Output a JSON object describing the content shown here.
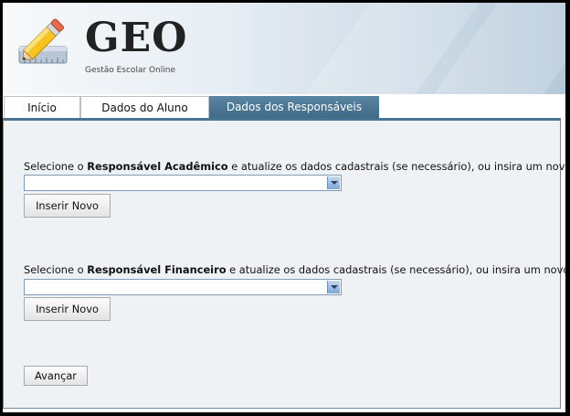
{
  "brand": {
    "name": "GEO",
    "tagline": "Gestão Escolar Online"
  },
  "tabs": [
    {
      "label": "Início",
      "active": false
    },
    {
      "label": "Dados do Aluno",
      "active": false
    },
    {
      "label": "Dados dos Responsáveis",
      "active": true
    }
  ],
  "academic": {
    "prefix": "Selecione o ",
    "emphasis": "Responsável Acadêmico",
    "suffix": " e atualize os dados cadastrais (se necessário), ou insira um novo",
    "selected_value": "",
    "insert_label": "Inserir Novo"
  },
  "financial": {
    "prefix": "Selecione o ",
    "emphasis": "Responsável Financeiro",
    "suffix": " e atualize os dados cadastrais (se necessário), ou insira um novo",
    "selected_value": "",
    "insert_label": "Inserir Novo"
  },
  "advance_label": "Avançar",
  "colors": {
    "accent": "#4a7592",
    "panel": "#eef2f5",
    "frame": "#000000"
  },
  "icons": [
    "pencil-ruler-icon",
    "chevron-down-icon"
  ]
}
